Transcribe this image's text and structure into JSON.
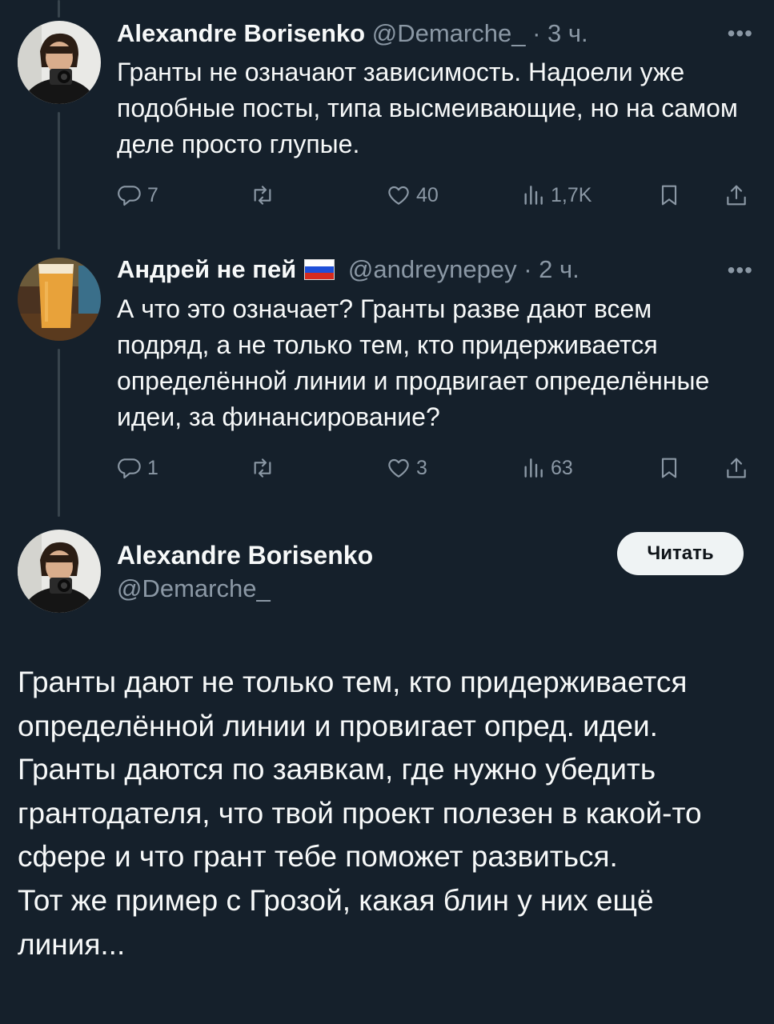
{
  "tweets": [
    {
      "author_name": "Alexandre Borisenko",
      "handle": "@Demarche_",
      "separator": "·",
      "time": "3 ч.",
      "text": "Гранты не означают зависимость. Надоели уже подобные посты, типа высмеивающие, но на самом деле просто глупые.",
      "replies": "7",
      "retweets": "",
      "likes": "40",
      "views": "1,7K"
    },
    {
      "author_name": "Андрей не пей",
      "handle": "@andreynepey",
      "separator": "·",
      "time": "2 ч.",
      "text": "А что это означает? Гранты разве дают всем подряд, а не только тем, кто придерживается определённой линии и продвигает определённые идеи, за финансирование?",
      "replies": "1",
      "retweets": "",
      "likes": "3",
      "views": "63"
    }
  ],
  "main_tweet": {
    "author_name": "Alexandre Borisenko",
    "handle": "@Demarche_",
    "follow_label": "Читать",
    "text": "Гранты дают не только тем, кто придерживается определённой линии и провигает опред. идеи. Гранты даются по заявкам, где нужно убедить грантодателя, что твой проект полезен в какой-то сфере и что грант тебе поможет развиться.\nТот же пример с Грозой, какая блин у них ещё линия..."
  },
  "icons": {
    "reply": "reply-icon",
    "retweet": "retweet-icon",
    "like": "heart-icon",
    "views": "views-icon",
    "bookmark": "bookmark-icon",
    "share": "share-icon",
    "more": "more-icon",
    "flag": "russia-flag-icon"
  },
  "colors": {
    "background": "#15202b",
    "text": "#f7f9f9",
    "secondary_text": "#8b98a5",
    "thread_line": "#38444d",
    "follow_button": "#eff3f4"
  }
}
